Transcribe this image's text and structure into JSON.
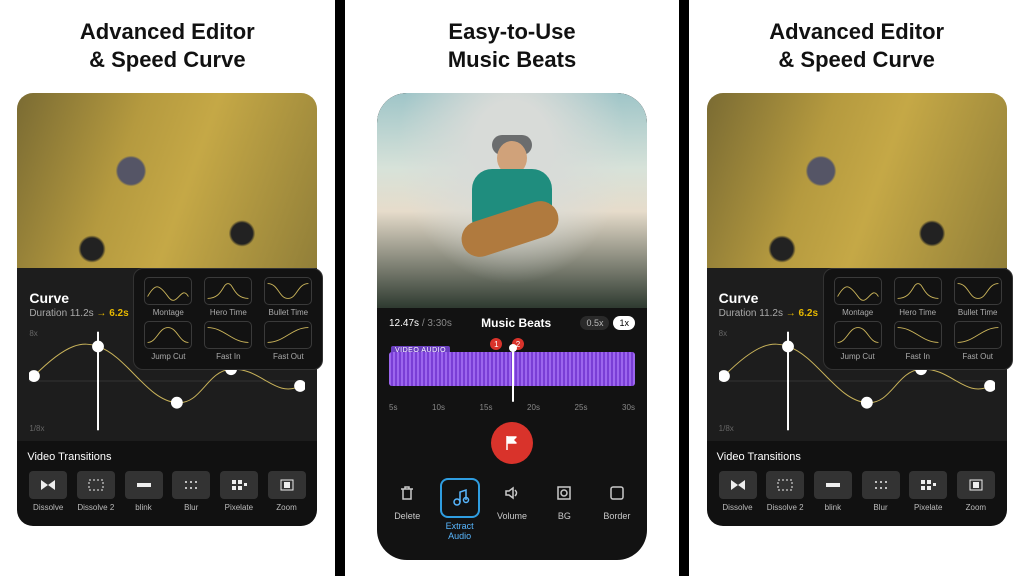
{
  "panels": {
    "editor": {
      "title_l1": "Advanced Editor",
      "title_l2": "& Speed Curve",
      "curve_label": "Curve",
      "duration_prefix": "Duration ",
      "duration_from": "11.2s",
      "duration_to": "6.2s",
      "y_top": "8x",
      "y_bot": "1/8x",
      "presets": [
        {
          "label": "Montage"
        },
        {
          "label": "Hero Time"
        },
        {
          "label": "Bullet Time"
        },
        {
          "label": "Jump Cut"
        },
        {
          "label": "Fast In"
        },
        {
          "label": "Fast Out"
        }
      ],
      "transitions_title": "Video Transitions",
      "transitions": [
        {
          "label": "Dissolve",
          "icon": "dissolve"
        },
        {
          "label": "Dissolve 2",
          "icon": "dissolve2"
        },
        {
          "label": "blink",
          "icon": "blink"
        },
        {
          "label": "Blur",
          "icon": "blur"
        },
        {
          "label": "Pixelate",
          "icon": "pixelate"
        },
        {
          "label": "Zoom",
          "icon": "zoom"
        }
      ]
    },
    "beats": {
      "title_l1": "Easy-to-Use",
      "title_l2": "Music Beats",
      "time_cur": "12.47s",
      "time_tot": "/ 3:30s",
      "name": "Music Beats",
      "speeds": [
        {
          "label": "0.5x",
          "active": false
        },
        {
          "label": "1x",
          "active": true
        }
      ],
      "audio_label": "VIDEO AUDIO",
      "ticks": [
        "5s",
        "10s",
        "15s",
        "20s",
        "25s",
        "30s"
      ],
      "markers": [
        "1",
        "2"
      ],
      "tools": [
        {
          "label": "Delete",
          "icon": "trash"
        },
        {
          "label": "Extract\nAudio",
          "icon": "extract",
          "active": true
        },
        {
          "label": "Volume",
          "icon": "volume"
        },
        {
          "label": "BG",
          "icon": "bg"
        },
        {
          "label": "Border",
          "icon": "border"
        }
      ]
    }
  }
}
